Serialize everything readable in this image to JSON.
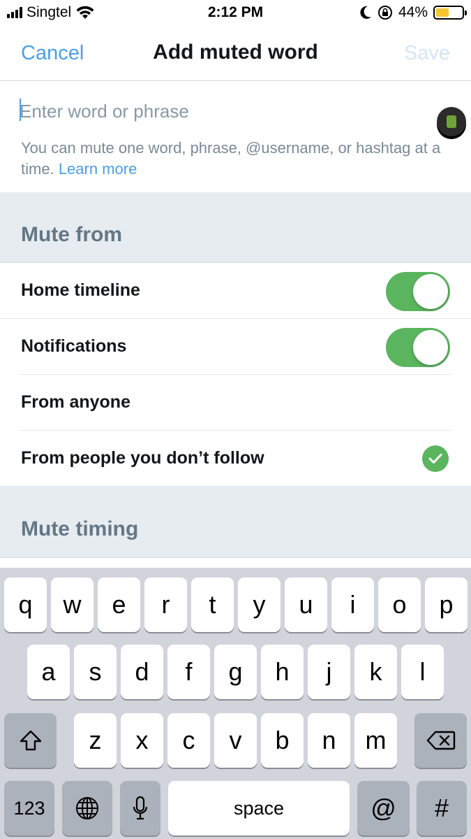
{
  "status_bar": {
    "carrier": "Singtel",
    "time": "2:12 PM",
    "battery_percent": "44%",
    "battery_level": 0.44,
    "icons": [
      "signal-icon",
      "wifi-icon",
      "moon-icon",
      "rotation-lock-icon",
      "battery-icon"
    ]
  },
  "nav": {
    "cancel_label": "Cancel",
    "title": "Add muted word",
    "save_label": "Save"
  },
  "input": {
    "placeholder": "Enter word or phrase",
    "value": "",
    "help_text": "You can mute one word, phrase, @username, or hashtag at a time.",
    "learn_more_label": "Learn more"
  },
  "mute_from": {
    "header": "Mute from",
    "home_timeline": {
      "label": "Home timeline",
      "enabled": true
    },
    "notifications": {
      "label": "Notifications",
      "enabled": true
    },
    "from_anyone": {
      "label": "From anyone",
      "selected": false
    },
    "from_people_you_dont_follow": {
      "label": "From people you don’t follow",
      "selected": true
    }
  },
  "mute_timing": {
    "header": "Mute timing"
  },
  "keyboard": {
    "row1": [
      "q",
      "w",
      "e",
      "r",
      "t",
      "y",
      "u",
      "i",
      "o",
      "p"
    ],
    "row2": [
      "a",
      "s",
      "d",
      "f",
      "g",
      "h",
      "j",
      "k",
      "l"
    ],
    "row3": [
      "z",
      "x",
      "c",
      "v",
      "b",
      "n",
      "m"
    ],
    "numbers_label": "123",
    "space_label": "space",
    "at_label": "@",
    "hash_label": "#"
  },
  "colors": {
    "accent_blue": "#4a9fe8",
    "toggle_green": "#5ab55e",
    "section_bg": "#e6ecf0",
    "section_text": "#657786"
  }
}
